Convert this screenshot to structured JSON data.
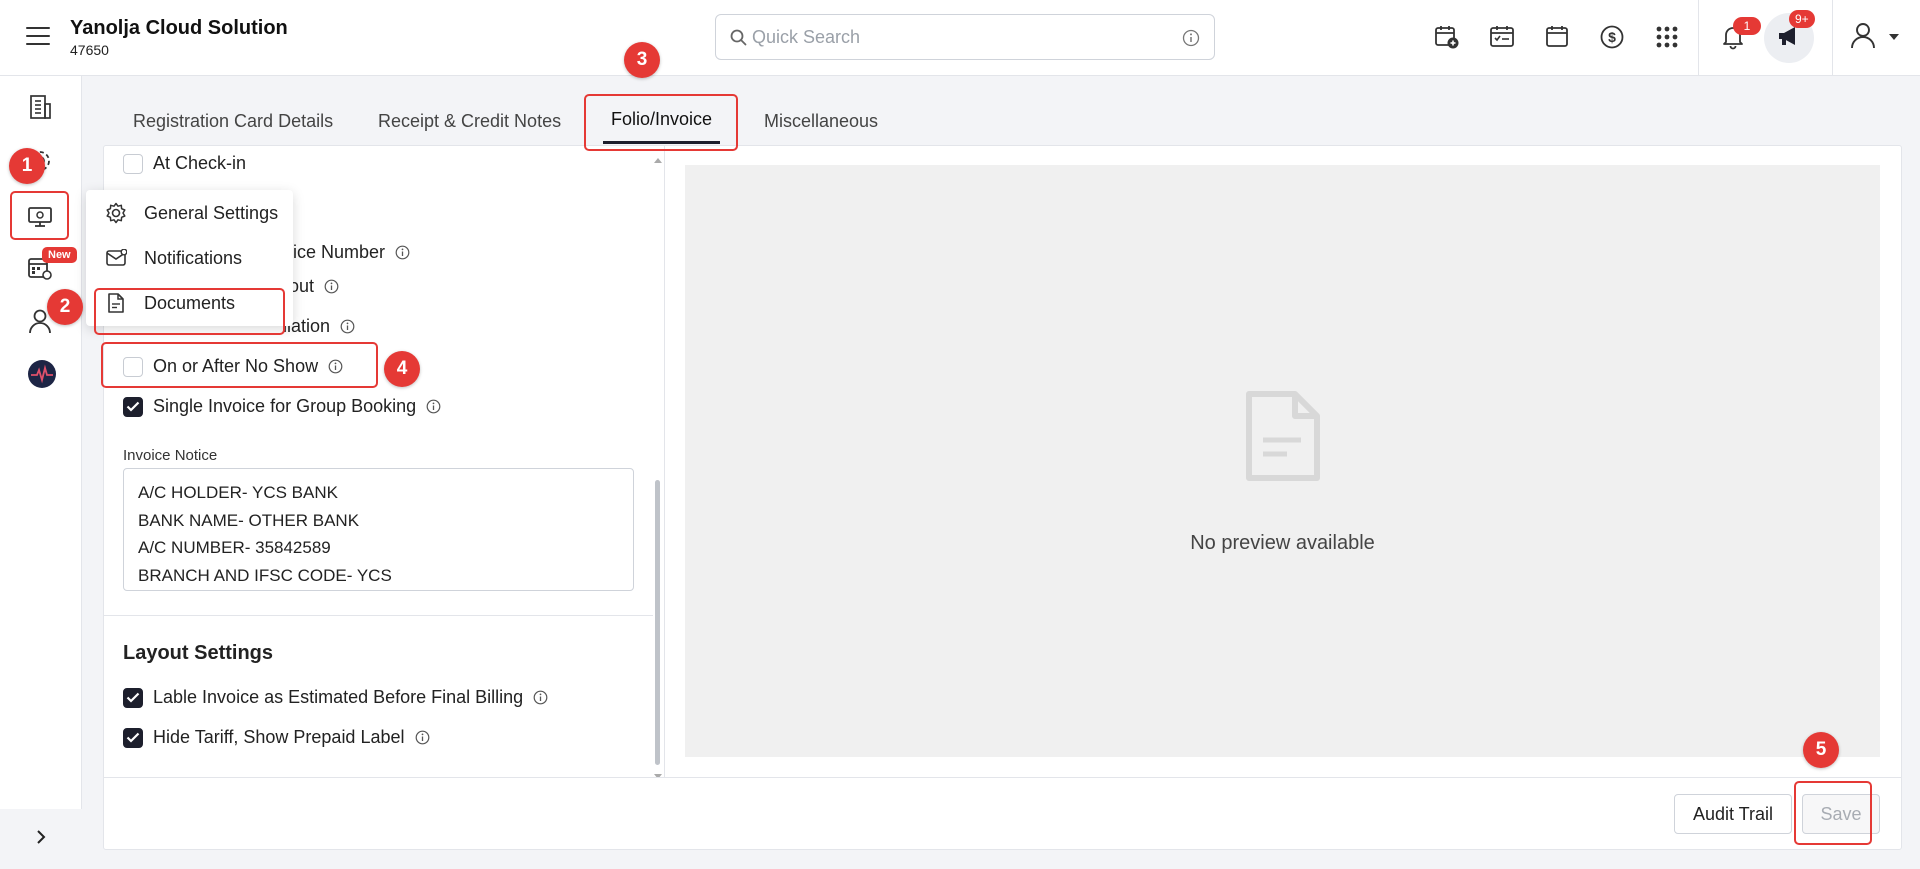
{
  "header": {
    "brand_name": "Yanolja Cloud Solution",
    "brand_id": "47650",
    "search_placeholder": "Quick Search",
    "notification_count": "1",
    "announcement_count": "9+"
  },
  "sidebar": {
    "new_badge": "New"
  },
  "tabs": [
    {
      "label": "Registration Card Details"
    },
    {
      "label": "Receipt & Credit Notes"
    },
    {
      "label": "Folio/Invoice",
      "active": true
    },
    {
      "label": "Miscellaneous"
    }
  ],
  "menu": {
    "items": [
      {
        "label": "General Settings",
        "icon": "gear-icon"
      },
      {
        "label": "Notifications",
        "icon": "mail-icon"
      },
      {
        "label": "Documents",
        "icon": "document-icon"
      }
    ]
  },
  "settings": {
    "at_checkin": {
      "label": "At Check-in",
      "checked": false
    },
    "invoice_number_partial": "oice Number",
    "checkout_partial": "-out",
    "cancellation_partial": "llation",
    "no_show": {
      "label": "On or After No Show",
      "checked": false
    },
    "single_invoice": {
      "label": "Single Invoice for Group Booking",
      "checked": true
    },
    "invoice_notice_label": "Invoice Notice",
    "invoice_notice_lines": [
      "A/C HOLDER- YCS BANK",
      "BANK NAME- OTHER BANK",
      "A/C NUMBER- 35842589",
      "BRANCH AND IFSC CODE- YCS"
    ],
    "layout_title": "Layout Settings",
    "label_estimated": {
      "label": "Lable Invoice as Estimated Before Final Billing",
      "checked": true
    },
    "hide_tariff": {
      "label": "Hide Tariff, Show Prepaid Label",
      "checked": true
    }
  },
  "preview": {
    "empty_text": "No preview available"
  },
  "footer": {
    "audit_trail_label": "Audit Trail",
    "save_label": "Save"
  },
  "annotations": {
    "step1": "1",
    "step2": "2",
    "step3": "3",
    "step4": "4",
    "step5": "5",
    "color": "#e53935"
  }
}
